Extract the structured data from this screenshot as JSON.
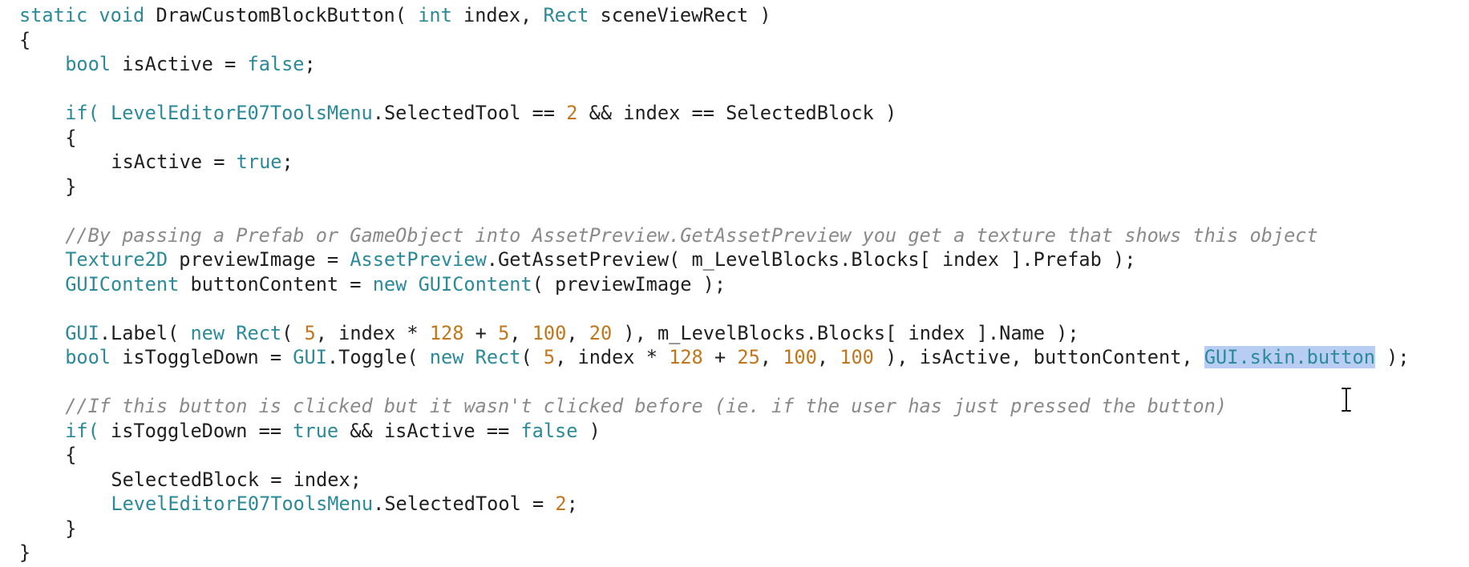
{
  "code_editor": {
    "language": "C#",
    "colors": {
      "keyword": "#2a8a98",
      "number": "#c2761c",
      "comment": "#8a8a8a",
      "text": "#1f1f1f",
      "selection": "#b8cdf2"
    },
    "lines": [
      [
        {
          "t": "static void ",
          "c": "kw"
        },
        {
          "t": "DrawCustomBlockButton( ",
          "c": "plain"
        },
        {
          "t": "int",
          "c": "type"
        },
        {
          "t": " index, ",
          "c": "plain"
        },
        {
          "t": "Rect",
          "c": "cls"
        },
        {
          "t": " sceneViewRect )",
          "c": "plain"
        }
      ],
      [
        {
          "t": "{",
          "c": "plain"
        }
      ],
      [
        {
          "t": "bool",
          "c": "type"
        },
        {
          "t": " isActive = ",
          "c": "plain"
        },
        {
          "t": "false",
          "c": "kw"
        },
        {
          "t": ";",
          "c": "plain"
        }
      ],
      [],
      [
        {
          "t": "if( ",
          "c": "kw"
        },
        {
          "t": "LevelEditorE07ToolsMenu",
          "c": "cls"
        },
        {
          "t": ".SelectedTool == ",
          "c": "plain"
        },
        {
          "t": "2",
          "c": "num"
        },
        {
          "t": " && index == SelectedBlock )",
          "c": "plain"
        }
      ],
      [
        {
          "t": "{",
          "c": "plain"
        }
      ],
      [
        {
          "t": "isActive = ",
          "c": "plain"
        },
        {
          "t": "true",
          "c": "kw"
        },
        {
          "t": ";",
          "c": "plain"
        }
      ],
      [
        {
          "t": "}",
          "c": "plain"
        }
      ],
      [],
      [
        {
          "t": "//By passing a Prefab or GameObject into AssetPreview.GetAssetPreview you get a texture that shows this object",
          "c": "cmt"
        }
      ],
      [
        {
          "t": "Texture2D",
          "c": "cls"
        },
        {
          "t": " previewImage = ",
          "c": "plain"
        },
        {
          "t": "AssetPreview",
          "c": "cls"
        },
        {
          "t": ".GetAssetPreview( m_LevelBlocks.Blocks[ index ].Prefab );",
          "c": "plain"
        }
      ],
      [
        {
          "t": "GUIContent",
          "c": "cls"
        },
        {
          "t": " buttonContent = ",
          "c": "plain"
        },
        {
          "t": "new",
          "c": "kw"
        },
        {
          "t": " ",
          "c": "plain"
        },
        {
          "t": "GUIContent",
          "c": "cls"
        },
        {
          "t": "( previewImage );",
          "c": "plain"
        }
      ],
      [],
      [
        {
          "t": "GUI",
          "c": "cls"
        },
        {
          "t": ".Label( ",
          "c": "plain"
        },
        {
          "t": "new",
          "c": "kw"
        },
        {
          "t": " ",
          "c": "plain"
        },
        {
          "t": "Rect",
          "c": "cls"
        },
        {
          "t": "( ",
          "c": "plain"
        },
        {
          "t": "5",
          "c": "num"
        },
        {
          "t": ", index * ",
          "c": "plain"
        },
        {
          "t": "128",
          "c": "num"
        },
        {
          "t": " + ",
          "c": "plain"
        },
        {
          "t": "5",
          "c": "num"
        },
        {
          "t": ", ",
          "c": "plain"
        },
        {
          "t": "100",
          "c": "num"
        },
        {
          "t": ", ",
          "c": "plain"
        },
        {
          "t": "20",
          "c": "num"
        },
        {
          "t": " ), m_LevelBlocks.Blocks[ index ].Name );",
          "c": "plain"
        }
      ],
      [
        {
          "t": "bool",
          "c": "type"
        },
        {
          "t": " isToggleDown = ",
          "c": "plain"
        },
        {
          "t": "GUI",
          "c": "cls"
        },
        {
          "t": ".Toggle( ",
          "c": "plain"
        },
        {
          "t": "new",
          "c": "kw"
        },
        {
          "t": " ",
          "c": "plain"
        },
        {
          "t": "Rect",
          "c": "cls"
        },
        {
          "t": "( ",
          "c": "plain"
        },
        {
          "t": "5",
          "c": "num"
        },
        {
          "t": ", index * ",
          "c": "plain"
        },
        {
          "t": "128",
          "c": "num"
        },
        {
          "t": " + ",
          "c": "plain"
        },
        {
          "t": "25",
          "c": "num"
        },
        {
          "t": ", ",
          "c": "plain"
        },
        {
          "t": "100",
          "c": "num"
        },
        {
          "t": ", ",
          "c": "plain"
        },
        {
          "t": "100",
          "c": "num"
        },
        {
          "t": " ), isActive, buttonContent, ",
          "c": "plain"
        },
        {
          "t": "GUI.skin.button",
          "c": "cls",
          "selected": true
        },
        {
          "t": " );",
          "c": "plain"
        }
      ],
      [],
      [
        {
          "t": "//If this button is clicked but it wasn't clicked before (ie. if the user has just pressed the button)",
          "c": "cmt"
        }
      ],
      [
        {
          "t": "if( ",
          "c": "kw"
        },
        {
          "t": "isToggleDown == ",
          "c": "plain"
        },
        {
          "t": "true",
          "c": "kw"
        },
        {
          "t": " && isActive == ",
          "c": "plain"
        },
        {
          "t": "false",
          "c": "kw"
        },
        {
          "t": " )",
          "c": "plain"
        }
      ],
      [
        {
          "t": "{",
          "c": "plain"
        }
      ],
      [
        {
          "t": "SelectedBlock = index;",
          "c": "plain"
        }
      ],
      [
        {
          "t": "LevelEditorE07ToolsMenu",
          "c": "cls"
        },
        {
          "t": ".SelectedTool = ",
          "c": "plain"
        },
        {
          "t": "2",
          "c": "num"
        },
        {
          "t": ";",
          "c": "plain"
        }
      ],
      [
        {
          "t": "}",
          "c": "plain"
        }
      ],
      [
        {
          "t": "}",
          "c": "plain"
        }
      ]
    ],
    "indent": [
      0,
      0,
      1,
      0,
      1,
      1,
      2,
      1,
      0,
      1,
      1,
      1,
      0,
      1,
      1,
      0,
      1,
      1,
      1,
      2,
      2,
      1,
      0
    ],
    "cursor_icon": "text-ibeam-cursor-icon"
  }
}
